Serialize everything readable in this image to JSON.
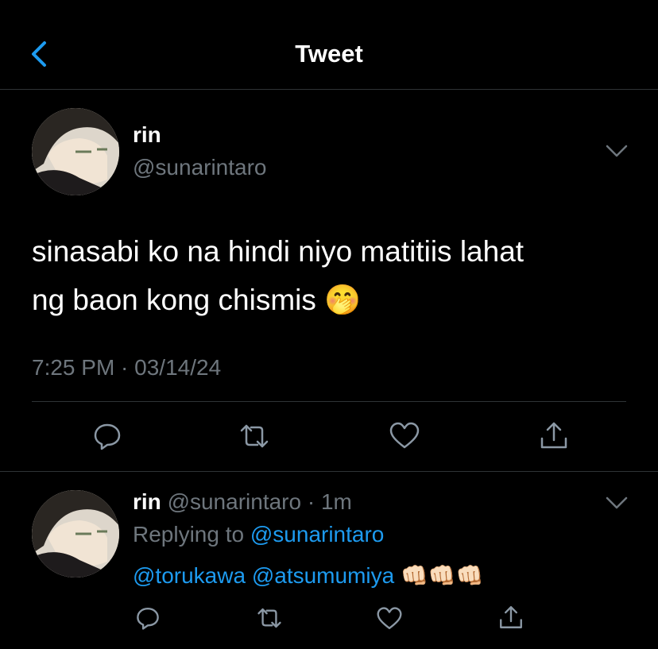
{
  "header": {
    "title": "Tweet",
    "back_icon": "chevron-left-icon"
  },
  "main_tweet": {
    "display_name": "rin",
    "handle": "@sunarintaro",
    "text_line1": "sinasabi ko na hindi niyo matitiis lahat",
    "text_line2": "ng baon kong chismis",
    "emoji": "🤭",
    "timestamp": "7:25 PM · 03/14/24",
    "actions": [
      "reply-icon",
      "retweet-icon",
      "like-icon",
      "share-icon"
    ]
  },
  "reply": {
    "display_name": "rin",
    "handle": "@sunarintaro",
    "age": "1m",
    "replying_label": "Replying to",
    "replying_to": "@sunarintaro",
    "mention1": "@torukawa",
    "mention2": "@atsumumiya",
    "emojis": "👊🏻👊🏻👊🏻",
    "actions": [
      "reply-icon",
      "retweet-icon",
      "like-icon",
      "share-icon"
    ]
  },
  "colors": {
    "background": "#000000",
    "link": "#1d9bf0",
    "muted": "#6e767d",
    "divider": "#2f3336"
  }
}
